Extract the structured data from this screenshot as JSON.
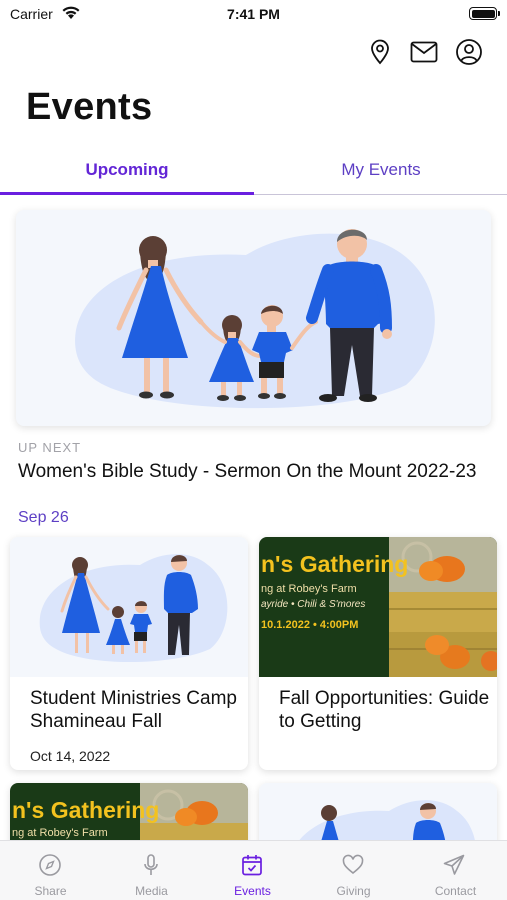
{
  "status_bar": {
    "carrier": "Carrier",
    "time": "7:41 PM"
  },
  "header": {
    "title": "Events",
    "icons": [
      "location-pin-icon",
      "mail-icon",
      "profile-icon"
    ]
  },
  "tabs": [
    {
      "label": "Upcoming",
      "active": true
    },
    {
      "label": "My Events",
      "active": false
    }
  ],
  "hero": {
    "eyebrow": "UP NEXT",
    "title": "Women's Bible Study - Sermon On the Mount 2022-23",
    "date": "Sep 26"
  },
  "cards": [
    {
      "title": "Student Ministries Camp Shamineau Fall",
      "date": "Oct 14, 2022"
    },
    {
      "title": "Fall Opportunities: Guide to Getting",
      "image_text": {
        "headline": "n's Gathering",
        "line2": "ng at Robey's Farm",
        "line3": "ayride • Chili & S'mores",
        "line4": "10.1.2022 • 4:00PM"
      }
    },
    {
      "title": "",
      "image_text": {
        "headline": "n's Gathering",
        "line2": "ng at Robey's Farm"
      }
    },
    {
      "title": ""
    }
  ],
  "bottom_nav": [
    {
      "label": "Share",
      "icon": "compass-icon"
    },
    {
      "label": "Media",
      "icon": "microphone-icon"
    },
    {
      "label": "Events",
      "icon": "calendar-icon",
      "active": true
    },
    {
      "label": "Giving",
      "icon": "heart-icon"
    },
    {
      "label": "Contact",
      "icon": "paper-plane-icon"
    }
  ],
  "colors": {
    "accent": "#6a1fe0",
    "tab_text": "#5d3fc4",
    "figure_blue": "#1f5fe0",
    "farm_green": "#1a3a17",
    "farm_yellow": "#f3c21f"
  }
}
